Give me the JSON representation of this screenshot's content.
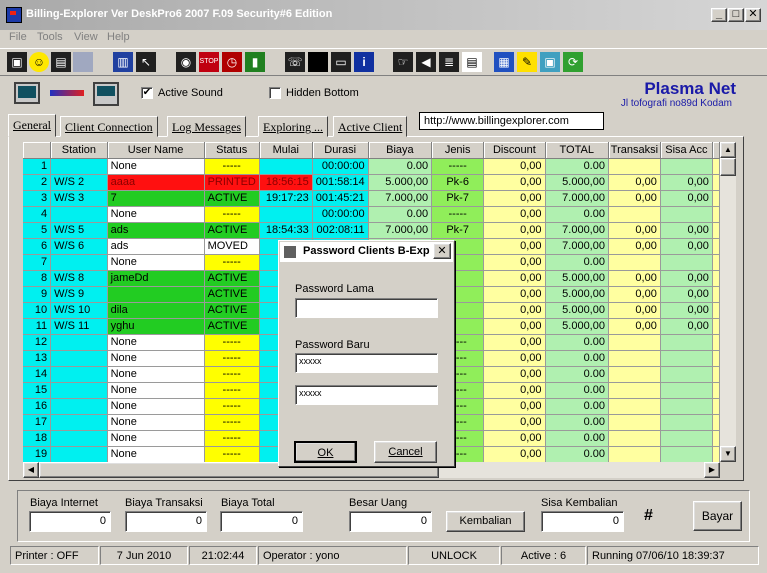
{
  "window": {
    "title": "Billing-Explorer Ver DeskPro6 2007 F.09 Security#6 Edition"
  },
  "menu": [
    "File",
    "Tools",
    "View",
    "Help"
  ],
  "toolbar_icons": [
    "terminal-icon",
    "smiley-icon",
    "disk-icon",
    "blank-icon",
    "computer-icon",
    "pointer-icon",
    "eye-icon",
    "stop-icon",
    "clock-icon",
    "battery-icon",
    "phone-icon",
    "black-square-icon",
    "printer-icon",
    "info-icon",
    "hand-icon",
    "speaker-icon",
    "list-icon",
    "notepad-icon",
    "document-icon",
    "pen-icon",
    "window-icon",
    "refresh-icon"
  ],
  "brand": {
    "title": "Plasma Net",
    "subtitle": "Jl tofografi no89d Kodam"
  },
  "options": {
    "active_sound_label": "Active Sound",
    "active_sound_checked": true,
    "hidden_bottom_label": "Hidden Bottom",
    "hidden_bottom_checked": false
  },
  "tabs": [
    "General",
    "Client Connection",
    "Log Messages",
    "Exploring ...",
    "Active Client"
  ],
  "url": "http://www.billingexplorer.com",
  "grid": {
    "columns": [
      "",
      "Station",
      "User Name",
      "Status",
      "Mulai",
      "Durasi",
      "Biaya",
      "Jenis",
      "Discount",
      "TOTAL",
      "Transaksi",
      "Sisa Acc",
      ""
    ],
    "rows": [
      {
        "kind": "yellow",
        "cells": [
          "1",
          "",
          "None",
          "-----",
          "",
          "00:00:00",
          "0.00",
          "-----",
          "0,00",
          "0.00",
          "",
          "",
          ""
        ]
      },
      {
        "kind": "red",
        "cells": [
          "2",
          "W/S 2",
          "aaaa",
          "PRINTED",
          "18:56:15",
          "001:58:14",
          "5.000,00",
          "Pk-6",
          "0,00",
          "5.000,00",
          "0,00",
          "0,00",
          ""
        ]
      },
      {
        "kind": "green",
        "cells": [
          "3",
          "W/S 3",
          "7",
          "ACTIVE",
          "19:17:23",
          "001:45:21",
          "7.000,00",
          "Pk-7",
          "0,00",
          "7.000,00",
          "0,00",
          "0,00",
          ""
        ]
      },
      {
        "kind": "yellow",
        "cells": [
          "4",
          "",
          "None",
          "-----",
          "",
          "00:00:00",
          "0.00",
          "-----",
          "0,00",
          "0.00",
          "",
          "",
          ""
        ]
      },
      {
        "kind": "green",
        "cells": [
          "5",
          "W/S 5",
          "ads",
          "ACTIVE",
          "18:54:33",
          "002:08:11",
          "7.000,00",
          "Pk-7",
          "0,00",
          "7.000,00",
          "0,00",
          "0,00",
          ""
        ]
      },
      {
        "kind": "white",
        "cells": [
          "6",
          "W/S 6",
          "ads",
          "MOVED",
          "1",
          "",
          "",
          "",
          "0,00",
          "7.000,00",
          "0,00",
          "0,00",
          ""
        ]
      },
      {
        "kind": "yellow",
        "cells": [
          "7",
          "",
          "None",
          "-----",
          "",
          "",
          "",
          "",
          "0,00",
          "0.00",
          "",
          "",
          ""
        ]
      },
      {
        "kind": "green",
        "cells": [
          "8",
          "W/S 8",
          "jameDd",
          "ACTIVE",
          "1",
          "",
          "",
          "",
          "0,00",
          "5.000,00",
          "0,00",
          "0,00",
          ""
        ]
      },
      {
        "kind": "green",
        "cells": [
          "9",
          "W/S 9",
          "",
          "ACTIVE",
          "2",
          "",
          "",
          "",
          "0,00",
          "5.000,00",
          "0,00",
          "0,00",
          ""
        ]
      },
      {
        "kind": "green",
        "cells": [
          "10",
          "W/S 10",
          "dila",
          "ACTIVE",
          "2",
          "",
          "",
          "",
          "0,00",
          "5.000,00",
          "0,00",
          "0,00",
          ""
        ]
      },
      {
        "kind": "green",
        "cells": [
          "11",
          "W/S 11",
          "yghu",
          "ACTIVE",
          "1",
          "",
          "",
          "",
          "0,00",
          "5.000,00",
          "0,00",
          "0,00",
          ""
        ]
      },
      {
        "kind": "yellow",
        "cells": [
          "12",
          "",
          "None",
          "-----",
          "",
          "",
          "",
          "-----",
          "0,00",
          "0.00",
          "",
          "",
          ""
        ]
      },
      {
        "kind": "yellow",
        "cells": [
          "13",
          "",
          "None",
          "-----",
          "",
          "",
          "",
          "-----",
          "0,00",
          "0.00",
          "",
          "",
          ""
        ]
      },
      {
        "kind": "yellow",
        "cells": [
          "14",
          "",
          "None",
          "-----",
          "",
          "",
          "",
          "-----",
          "0,00",
          "0.00",
          "",
          "",
          ""
        ]
      },
      {
        "kind": "yellow",
        "cells": [
          "15",
          "",
          "None",
          "-----",
          "",
          "",
          "",
          "-----",
          "0,00",
          "0.00",
          "",
          "",
          ""
        ]
      },
      {
        "kind": "yellow",
        "cells": [
          "16",
          "",
          "None",
          "-----",
          "",
          "",
          "",
          "-----",
          "0,00",
          "0.00",
          "",
          "",
          ""
        ]
      },
      {
        "kind": "yellow",
        "cells": [
          "17",
          "",
          "None",
          "-----",
          "",
          "",
          "",
          "-----",
          "0,00",
          "0.00",
          "",
          "",
          ""
        ]
      },
      {
        "kind": "yellow",
        "cells": [
          "18",
          "",
          "None",
          "-----",
          "",
          "",
          "",
          "-----",
          "0,00",
          "0.00",
          "",
          "",
          ""
        ]
      },
      {
        "kind": "yellow",
        "cells": [
          "19",
          "",
          "None",
          "-----",
          "",
          "",
          "",
          "-----",
          "0,00",
          "0.00",
          "",
          "",
          ""
        ]
      }
    ]
  },
  "dialog": {
    "title": "Password Clients B-Exp",
    "old_label": "Password Lama",
    "old_value": "",
    "new_label": "Password Baru",
    "new_value": "xxxxx",
    "confirm_value": "xxxxx",
    "ok_label": "OK",
    "cancel_label": "Cancel"
  },
  "bottom": {
    "biaya_internet_label": "Biaya Internet",
    "biaya_internet": "0",
    "biaya_transaksi_label": "Biaya Transaksi",
    "biaya_transaksi": "0",
    "biaya_total_label": "Biaya Total",
    "biaya_total": "0",
    "besar_uang_label": "Besar Uang",
    "besar_uang": "0",
    "kembalian_button": "Kembalian",
    "sisa_kembalian_label": "Sisa Kembalian",
    "sisa_kembalian": "0",
    "hash": "#",
    "bayar_button": "Bayar"
  },
  "status": {
    "printer": "Printer : OFF",
    "date": "7 Jun 2010",
    "time": "21:02:44",
    "operator": "Operator : yono",
    "lock": "UNLOCK",
    "active": "Active : 6",
    "running": "Running 07/06/10  18:39:37"
  }
}
